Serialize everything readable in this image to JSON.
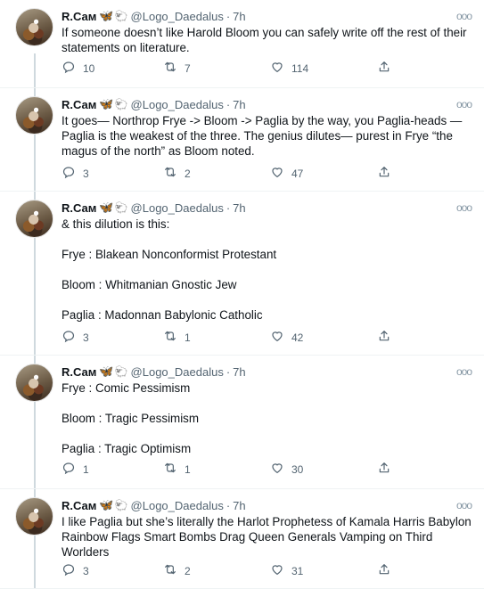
{
  "tweets": [
    {
      "name": "R.Сам",
      "handle": "@Logo_Daedalus",
      "time": "7h",
      "paragraphs": [
        "If someone doesn’t like Harold Bloom you can safely write off the rest of their statements on literature."
      ],
      "replies": "10",
      "retweets": "7",
      "likes": "114"
    },
    {
      "name": "R.Сам",
      "handle": "@Logo_Daedalus",
      "time": "7h",
      "paragraphs": [
        "It goes— Northrop Frye -> Bloom -> Paglia by the way, you Paglia-heads — Paglia is the weakest of the three. The genius dilutes— purest in Frye “the magus of the north” as Bloom noted."
      ],
      "replies": "3",
      "retweets": "2",
      "likes": "47"
    },
    {
      "name": "R.Сам",
      "handle": "@Logo_Daedalus",
      "time": "7h",
      "paragraphs": [
        "& this dilution is this:",
        "Frye : Blakean Nonconformist Protestant",
        "Bloom : Whitmanian Gnostic Jew",
        "Paglia : Madonnan Babylonic Catholic"
      ],
      "replies": "3",
      "retweets": "1",
      "likes": "42"
    },
    {
      "name": "R.Сам",
      "handle": "@Logo_Daedalus",
      "time": "7h",
      "paragraphs": [
        "Frye : Comic Pessimism",
        "Bloom : Tragic Pessimism",
        "Paglia : Tragic Optimism"
      ],
      "replies": "1",
      "retweets": "1",
      "likes": "30"
    },
    {
      "name": "R.Сам",
      "handle": "@Logo_Daedalus",
      "time": "7h",
      "paragraphs": [
        "I like Paglia but she’s literally the Harlot Prophetess of Kamala Harris Babylon Rainbow Flags Smart Bombs Drag Queen Generals Vamping on Third Worlders"
      ],
      "replies": "3",
      "retweets": "2",
      "likes": "31"
    }
  ],
  "ui": {
    "separator": "·",
    "more_glyph": "ooo"
  },
  "icons": {
    "badge_1": "butterfly-emoji",
    "badge_2": "sheep-emoji"
  },
  "colors": {
    "accent": "#1d9bf0",
    "muted": "#536471",
    "thread_line": "#cfd9de"
  }
}
